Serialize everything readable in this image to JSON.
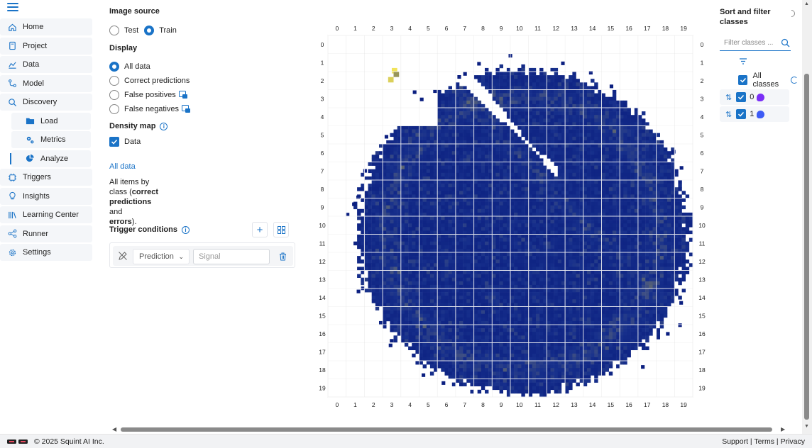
{
  "sidebar": {
    "items": [
      {
        "label": "Home",
        "icon": "home-icon"
      },
      {
        "label": "Project",
        "icon": "project-icon"
      },
      {
        "label": "Data",
        "icon": "data-icon"
      },
      {
        "label": "Model",
        "icon": "model-icon"
      },
      {
        "label": "Discovery",
        "icon": "discovery-icon"
      },
      {
        "label": "Load",
        "icon": "folder-icon"
      },
      {
        "label": "Metrics",
        "icon": "gears-icon"
      },
      {
        "label": "Analyze",
        "icon": "pie-chart-icon"
      },
      {
        "label": "Triggers",
        "icon": "trigger-icon"
      },
      {
        "label": "Insights",
        "icon": "lightbulb-icon"
      },
      {
        "label": "Learning Center",
        "icon": "library-icon"
      },
      {
        "label": "Runner",
        "icon": "runner-icon"
      },
      {
        "label": "Settings",
        "icon": "settings-icon"
      }
    ]
  },
  "panel": {
    "image_source_title": "Image source",
    "source_test": "Test",
    "source_train": "Train",
    "selected_source": "Train",
    "display_title": "Display",
    "display_options": [
      "All data",
      "Correct predictions",
      "False positives",
      "False negatives"
    ],
    "selected_display": "All data",
    "density_title": "Density map",
    "density_data": "Data",
    "all_data_link": "All data",
    "desc_line1": "All items by",
    "desc_line2a": "class (",
    "desc_line2b": "correct",
    "desc_line3": "predictions",
    "desc_line3b": " and",
    "desc_line4": "errors",
    "desc_line4b": ").",
    "trigger_title": "Trigger conditions",
    "condition_select": "Prediction",
    "signal_placeholder": "Signal"
  },
  "heatmap": {
    "x_ticks": [
      "0",
      "1",
      "2",
      "3",
      "4",
      "5",
      "6",
      "7",
      "8",
      "9",
      "10",
      "11",
      "12",
      "13",
      "14",
      "15",
      "16",
      "17",
      "18",
      "19"
    ],
    "y_ticks": [
      "0",
      "1",
      "2",
      "3",
      "4",
      "5",
      "6",
      "7",
      "8",
      "9",
      "10",
      "11",
      "12",
      "13",
      "14",
      "15",
      "16",
      "17",
      "18",
      "19"
    ]
  },
  "classes": {
    "title_line1": "Sort and filter",
    "title_line2": "classes",
    "filter_placeholder": "Filter classes ...",
    "all_classes_label": "All classes",
    "rows": [
      {
        "label": "0",
        "color": "#7b2ff7"
      },
      {
        "label": "1",
        "color": "#3d5bf5"
      }
    ]
  },
  "footer": {
    "copyright": "© 2025 Squint AI Inc.",
    "support": "Support",
    "terms": "Terms",
    "privacy": "Privacy",
    "sep": "|"
  },
  "colors": {
    "accent": "#1a73c7",
    "heat_low": "#0b1f80",
    "heat_high": "#f1e35a"
  }
}
